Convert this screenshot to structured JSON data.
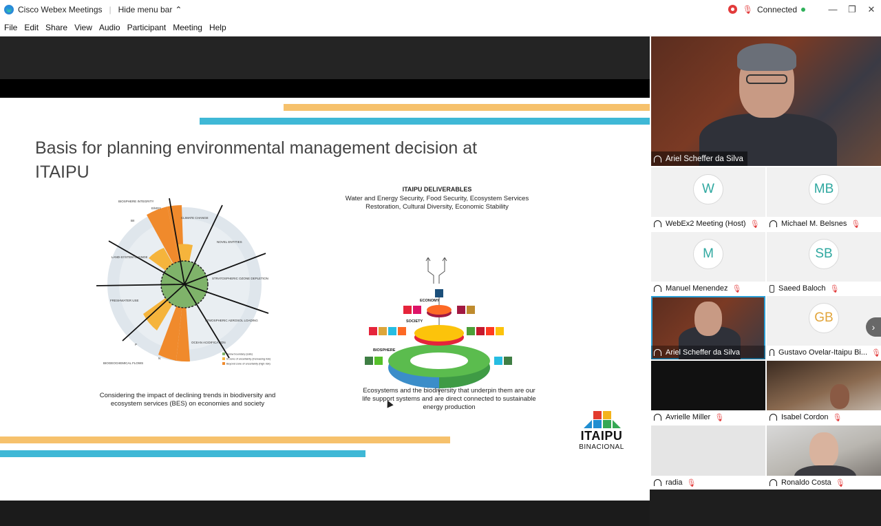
{
  "titlebar": {
    "app_title": "Cisco Webex Meetings",
    "hide_menu_label": "Hide menu bar",
    "status": "Connected"
  },
  "menu": [
    "File",
    "Edit",
    "Share",
    "View",
    "Audio",
    "Participant",
    "Meeting",
    "Help"
  ],
  "slide": {
    "title": "Basis for planning environmental management decision at ITAIPU",
    "deliverables_heading": "ITAIPU DELIVERABLES",
    "deliverables_line1": "Water and Energy Security, Food Security, Ecosystem Services",
    "deliverables_line2": "Restoration, Cultural Diversity, Economic Stability",
    "caption_left": "Considering the impact of declining trends in biodiversity and ecosystem services (BES) on economies and society",
    "caption_right": "Ecosystems and the biodiversity that underpin them are our life support systems and are direct connected to sustainable energy production",
    "logo_name": "ITAIPU",
    "logo_sub": "BINACIONAL",
    "boundaries_labels": [
      "BIOSPHERE INTEGRITY",
      "E/MSY",
      "BII",
      "CLIMATE CHANGE",
      "NOVEL ENTITIES",
      "STRATOSPHERIC OZONE DEPLETION",
      "ATMOSPHERIC AEROSOL LOADING",
      "OCEAN ACIDIFICATION",
      "BIOGEOCHEMICAL FLOWS",
      "P",
      "N",
      "FRESHWATER USE",
      "LAND-SYSTEM CHANGE"
    ],
    "boundaries_legend": [
      "Below boundary (safe)",
      "In zone of uncertainty (increasing risk)",
      "Beyond zone of uncertainty (high risk)"
    ],
    "wedding_labels": [
      "ECONOMY",
      "SOCIETY",
      "BIOSPHERE"
    ]
  },
  "active_speaker": {
    "name": "Ariel Scheffer da Silva"
  },
  "participants": [
    {
      "initials": "W",
      "name": "WebEx2 Meeting (Host)",
      "audio": "headset",
      "muted": true
    },
    {
      "initials": "MB",
      "name": "Michael M. Belsnes",
      "audio": "headset",
      "muted": true
    },
    {
      "initials": "M",
      "name": "Manuel Menendez",
      "audio": "headset",
      "muted": true
    },
    {
      "initials": "SB",
      "name": "Saeed Baloch",
      "audio": "phone",
      "muted": true
    },
    {
      "initials": "",
      "name": "Ariel Scheffer da Silva",
      "audio": "headset",
      "muted": false
    },
    {
      "initials": "GB",
      "name": "Gustavo Ovelar-Itaipu Bi...",
      "audio": "headset",
      "muted": true
    },
    {
      "initials": "",
      "name": "Avrielle Miller",
      "audio": "headset",
      "muted": true
    },
    {
      "initials": "",
      "name": "Isabel Cordon",
      "audio": "headset",
      "muted": true
    },
    {
      "initials": "",
      "name": "radia",
      "audio": "headset",
      "muted": true
    },
    {
      "initials": "",
      "name": "Ronaldo Costa",
      "audio": "headset",
      "muted": true
    }
  ],
  "colors": {
    "accent_blue": "#3fb8d6",
    "accent_orange": "#f6c16c",
    "selected_outline": "#2a9fd6",
    "mute_red": "#e23b3b",
    "avatar_teal": "#2fa8a0"
  }
}
